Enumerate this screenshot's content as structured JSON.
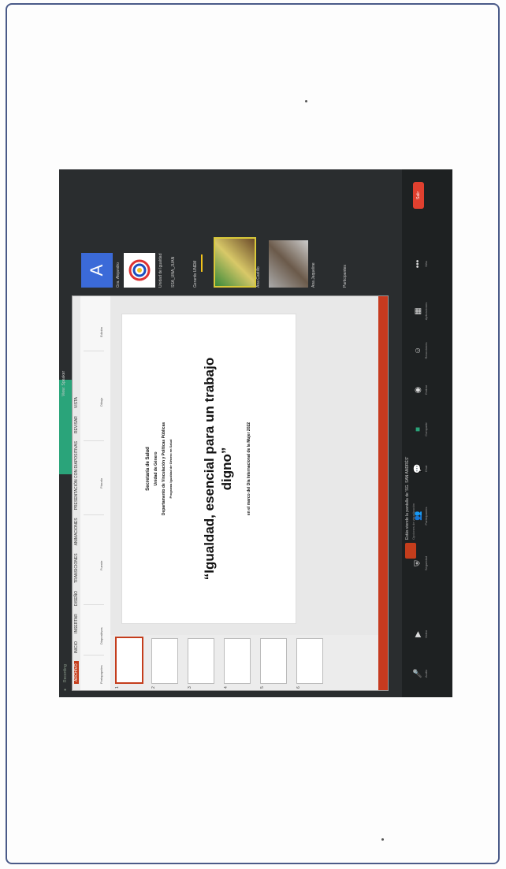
{
  "meeting": {
    "top_title": "Recording",
    "speaking_label": "View: Speaker",
    "participants": [
      {
        "name": "Gra. Alejandro",
        "kind": "avatar",
        "initial": "A"
      },
      {
        "name": "Unidad de Igualdad",
        "kind": "logo"
      },
      {
        "name": "SSA_UNA_JUAN",
        "kind": "name-only"
      },
      {
        "name": "Gerardo  UNEM",
        "kind": "name-only"
      },
      {
        "name": "Ana Castillo",
        "kind": "photo"
      },
      {
        "name": "Ana Jaqueline",
        "kind": "photo"
      },
      {
        "name": "Participantes",
        "kind": "footer"
      }
    ],
    "share_banner": "Estás viendo la pantalla de 'SG. SAN ANDRÉS'",
    "share_banner_sub": "Opciones de visualización",
    "end_label": "Salir"
  },
  "powerpoint": {
    "file_tab": "ARCHIVO",
    "tabs": [
      "INICIO",
      "INSERTAR",
      "DISEÑO",
      "TRANSICIONES",
      "ANIMACIONES",
      "PRESENTACIÓN CON DIAPOSITIVAS",
      "REVISAR",
      "VISTA"
    ],
    "groups": [
      "Portapapeles",
      "Diapositivas",
      "Fuente",
      "Párrafo",
      "Dibujo",
      "Edición"
    ],
    "slide_numbers": [
      "1",
      "2",
      "3",
      "4",
      "5",
      "6"
    ],
    "slide": {
      "line1": "Secretaría de Salud",
      "line2": "Unidad de Género",
      "line3": "Departamento de Vinculación y Políticas Públicas",
      "line4": "Programa Igualdad de Género en Salud",
      "title": "“Igualdad, esencial para un trabajo digno”",
      "subtitle": "en el marco del Día Internacional de la Mujer 2022"
    }
  },
  "toolbar": {
    "items": [
      "Audio",
      "Video",
      "Seguridad",
      "Participantes",
      "Chat",
      "Compartir",
      "Grabar",
      "Reacciones",
      "Aplicaciones",
      "Más"
    ]
  }
}
